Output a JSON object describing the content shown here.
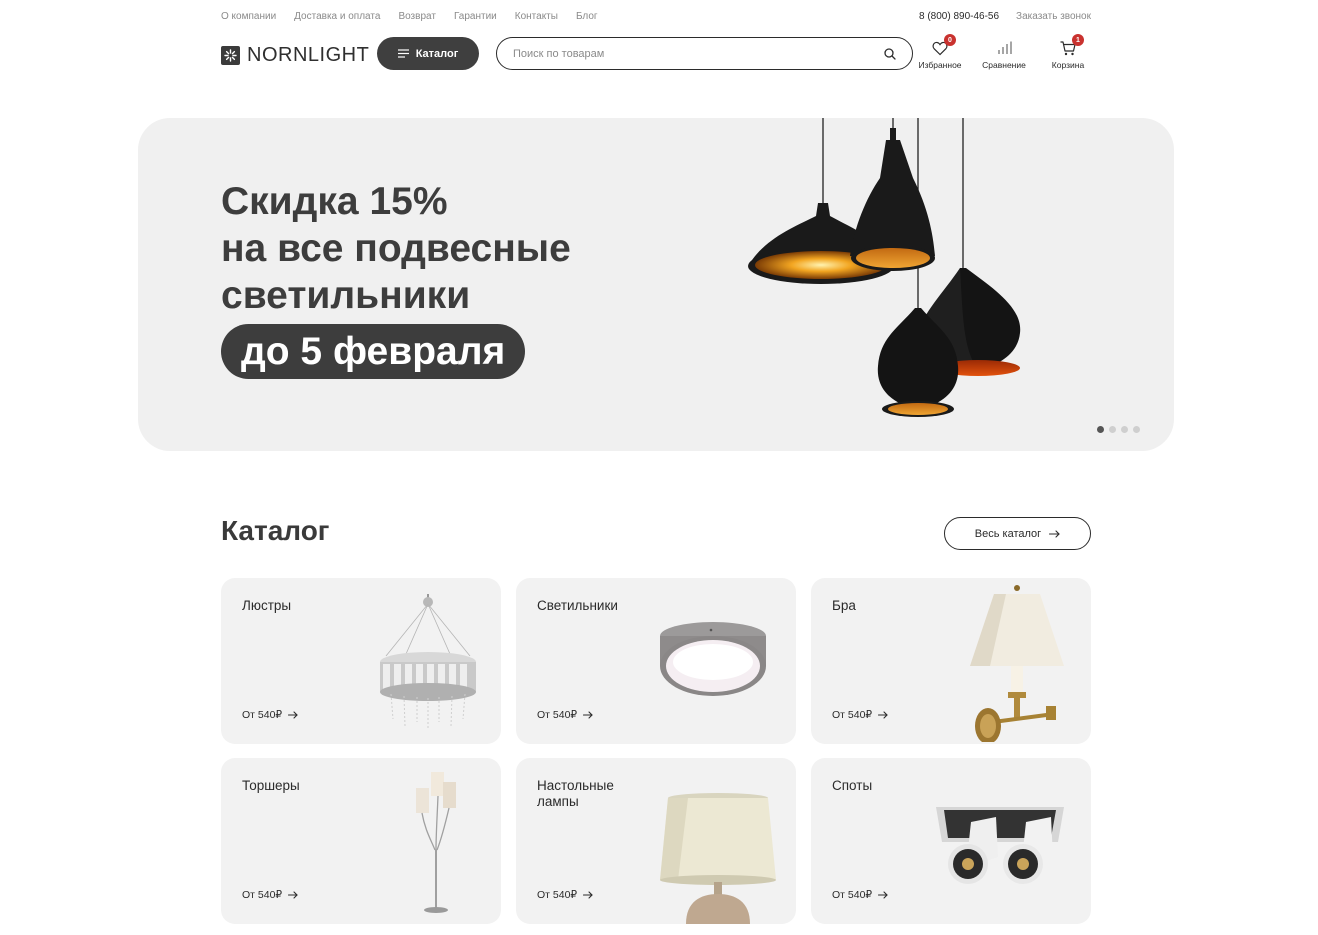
{
  "topnav": {
    "links": [
      "О компании",
      "Доставка и оплата",
      "Возврат",
      "Гарантии",
      "Контакты",
      "Блог"
    ],
    "phone": "8 (800) 890-46-56",
    "callback": "Заказать звонок"
  },
  "header": {
    "logo": "NORNLIGHT",
    "catalog_label": "Каталог",
    "search_placeholder": "Поиск по товарам",
    "favorites": {
      "label": "Избранное",
      "count": "0"
    },
    "compare": {
      "label": "Сравнение"
    },
    "cart": {
      "label": "Корзина",
      "count": "1"
    }
  },
  "hero": {
    "title": "Скидка 15%\nна все подвесные\nсветильники",
    "pill": "до 5 февраля",
    "slides_total": 4,
    "active_slide": 1
  },
  "catalog": {
    "title": "Каталог",
    "all_label": "Весь каталог",
    "items": [
      {
        "title": "Люстры",
        "price": "От 540₽"
      },
      {
        "title": "Светильники",
        "price": "От 540₽"
      },
      {
        "title": "Бра",
        "price": "От 540₽"
      },
      {
        "title": "Торшеры",
        "price": "От 540₽"
      },
      {
        "title": "Настольные лампы",
        "price": "От 540₽"
      },
      {
        "title": "Споты",
        "price": "От 540₽"
      }
    ]
  },
  "colors": {
    "accent_dark": "#3f3f3f",
    "badge_red": "#c9322f",
    "card_bg": "#f2f2f2"
  }
}
